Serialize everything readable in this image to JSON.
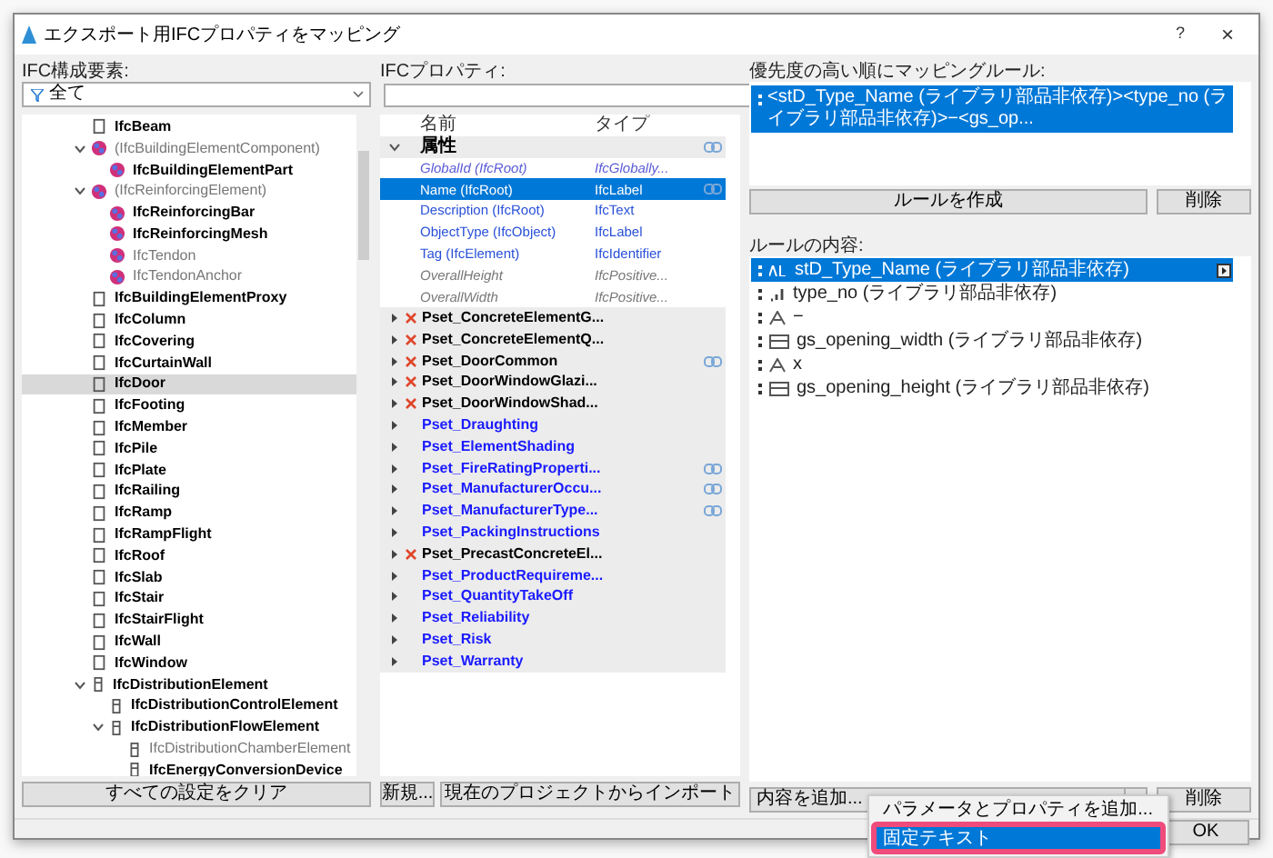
{
  "window": {
    "title": "エクスポート用IFCプロパティをマッピング",
    "help": "?",
    "close": "×"
  },
  "elements": {
    "label": "IFC構成要素:",
    "filter": "全て",
    "clear_button": "すべての設定をクリア",
    "tree": [
      {
        "label": "IfcBeam",
        "kind": "element",
        "dimmed": false,
        "selected": false
      },
      {
        "label": "(IfcBuildingElementComponent)",
        "kind": "component",
        "dimmed": true,
        "selected": false,
        "expanded": true,
        "children": [
          {
            "label": "IfcBuildingElementPart",
            "kind": "component",
            "dimmed": false,
            "selected": false
          }
        ]
      },
      {
        "label": "(IfcReinforcingElement)",
        "kind": "component",
        "dimmed": true,
        "selected": false,
        "expanded": true,
        "children": [
          {
            "label": "IfcReinforcingBar",
            "kind": "component",
            "dimmed": false,
            "selected": false
          },
          {
            "label": "IfcReinforcingMesh",
            "kind": "component",
            "dimmed": false,
            "selected": false
          },
          {
            "label": "IfcTendon",
            "kind": "component",
            "dimmed": true,
            "selected": false
          },
          {
            "label": "IfcTendonAnchor",
            "kind": "component",
            "dimmed": true,
            "selected": false
          }
        ]
      },
      {
        "label": "IfcBuildingElementProxy",
        "kind": "element",
        "dimmed": false,
        "selected": false
      },
      {
        "label": "IfcColumn",
        "kind": "element",
        "dimmed": false,
        "selected": false
      },
      {
        "label": "IfcCovering",
        "kind": "element",
        "dimmed": false,
        "selected": false
      },
      {
        "label": "IfcCurtainWall",
        "kind": "element",
        "dimmed": false,
        "selected": false
      },
      {
        "label": "IfcDoor",
        "kind": "element",
        "dimmed": false,
        "selected": true
      },
      {
        "label": "IfcFooting",
        "kind": "element",
        "dimmed": false,
        "selected": false
      },
      {
        "label": "IfcMember",
        "kind": "element",
        "dimmed": false,
        "selected": false
      },
      {
        "label": "IfcPile",
        "kind": "element",
        "dimmed": false,
        "selected": false
      },
      {
        "label": "IfcPlate",
        "kind": "element",
        "dimmed": false,
        "selected": false
      },
      {
        "label": "IfcRailing",
        "kind": "element",
        "dimmed": false,
        "selected": false
      },
      {
        "label": "IfcRamp",
        "kind": "element",
        "dimmed": false,
        "selected": false
      },
      {
        "label": "IfcRampFlight",
        "kind": "element",
        "dimmed": false,
        "selected": false
      },
      {
        "label": "IfcRoof",
        "kind": "element",
        "dimmed": false,
        "selected": false
      },
      {
        "label": "IfcSlab",
        "kind": "element",
        "dimmed": false,
        "selected": false
      },
      {
        "label": "IfcStair",
        "kind": "element",
        "dimmed": false,
        "selected": false
      },
      {
        "label": "IfcStairFlight",
        "kind": "element",
        "dimmed": false,
        "selected": false
      },
      {
        "label": "IfcWall",
        "kind": "element",
        "dimmed": false,
        "selected": false
      },
      {
        "label": "IfcWindow",
        "kind": "element",
        "dimmed": false,
        "selected": false
      },
      {
        "label": "IfcDistributionElement",
        "kind": "distribution",
        "dimmed": false,
        "selected": false,
        "expanded": true,
        "children": [
          {
            "label": "IfcDistributionControlElement",
            "kind": "distribution",
            "dimmed": false,
            "selected": false
          },
          {
            "label": "IfcDistributionFlowElement",
            "kind": "distribution",
            "dimmed": false,
            "selected": false,
            "expanded": true,
            "children": [
              {
                "label": "IfcDistributionChamberElement",
                "kind": "distribution",
                "dimmed": true,
                "selected": false
              },
              {
                "label": "IfcEnergyConversionDevice",
                "kind": "distribution",
                "dimmed": false,
                "selected": false
              }
            ]
          }
        ]
      }
    ]
  },
  "properties": {
    "label": "IFCプロパティ:",
    "columns": [
      "名前",
      "タイプ"
    ],
    "group": {
      "label": "属性",
      "expanded": true,
      "linked": true
    },
    "attributes": [
      {
        "name": "GlobalId (IfcRoot)",
        "type": "IfcGlobally...",
        "kind": "calculated",
        "linked": false,
        "selected": false
      },
      {
        "name": "Name (IfcRoot)",
        "type": "IfcLabel",
        "kind": "editable",
        "linked": true,
        "selected": true
      },
      {
        "name": "Description (IfcRoot)",
        "type": "IfcText",
        "kind": "editable",
        "linked": false,
        "selected": false
      },
      {
        "name": "ObjectType (IfcObject)",
        "type": "IfcLabel",
        "kind": "editable",
        "linked": false,
        "selected": false
      },
      {
        "name": "Tag (IfcElement)",
        "type": "IfcIdentifier",
        "kind": "editable",
        "linked": false,
        "selected": false
      },
      {
        "name": "OverallHeight",
        "type": "IfcPositive...",
        "kind": "unavailable",
        "linked": false,
        "selected": false
      },
      {
        "name": "OverallWidth",
        "type": "IfcPositive...",
        "kind": "unavailable",
        "linked": false,
        "selected": false
      }
    ],
    "psets": [
      {
        "name": "Pset_ConcreteElementG...",
        "missing": true,
        "linked": false
      },
      {
        "name": "Pset_ConcreteElementQ...",
        "missing": true,
        "linked": false
      },
      {
        "name": "Pset_DoorCommon",
        "missing": true,
        "linked": true
      },
      {
        "name": "Pset_DoorWindowGlazi...",
        "missing": true,
        "linked": false
      },
      {
        "name": "Pset_DoorWindowShad...",
        "missing": true,
        "linked": false
      },
      {
        "name": "Pset_Draughting",
        "missing": false,
        "linked": false
      },
      {
        "name": "Pset_ElementShading",
        "missing": false,
        "linked": false
      },
      {
        "name": "Pset_FireRatingProperti...",
        "missing": false,
        "linked": true
      },
      {
        "name": "Pset_ManufacturerOccu...",
        "missing": false,
        "linked": true
      },
      {
        "name": "Pset_ManufacturerType...",
        "missing": false,
        "linked": true
      },
      {
        "name": "Pset_PackingInstructions",
        "missing": false,
        "linked": false
      },
      {
        "name": "Pset_PrecastConcreteEl...",
        "missing": true,
        "linked": false
      },
      {
        "name": "Pset_ProductRequireme...",
        "missing": false,
        "linked": false
      },
      {
        "name": "Pset_QuantityTakeOff",
        "missing": false,
        "linked": false
      },
      {
        "name": "Pset_Reliability",
        "missing": false,
        "linked": false
      },
      {
        "name": "Pset_Risk",
        "missing": false,
        "linked": false
      },
      {
        "name": "Pset_Warranty",
        "missing": false,
        "linked": false
      }
    ],
    "buttons": [
      "新規...",
      "現在のプロジェクトからインポート"
    ]
  },
  "rules": {
    "label": "優先度の高い順にマッピングルール:",
    "items": [
      {
        "text": "<stD_Type_Name (ライブラリ部品非依存)><type_no (ライブラリ部品非依存)>−<gs_op...",
        "selected": true
      }
    ],
    "create_button": "ルールを作成",
    "delete_button": "削除"
  },
  "content": {
    "label": "ルールの内容:",
    "items": [
      {
        "text": "stD_Type_Name (ライブラリ部品非依存)",
        "kind": "string",
        "selected": true
      },
      {
        "text": "type_no (ライブラリ部品非依存)",
        "kind": "number",
        "selected": false
      },
      {
        "text": "−",
        "kind": "text",
        "selected": false
      },
      {
        "text": "gs_opening_width (ライブラリ部品非依存)",
        "kind": "length",
        "selected": false
      },
      {
        "text": "x",
        "kind": "text",
        "selected": false
      },
      {
        "text": "gs_opening_height (ライブラリ部品非依存)",
        "kind": "length",
        "selected": false
      }
    ],
    "add_button": "内容を追加...",
    "delete_button": "削除"
  },
  "menu": {
    "items": [
      {
        "label": "パラメータとプロパティを追加...",
        "selected": false,
        "highlighted": false
      },
      {
        "label": "固定テキスト",
        "selected": true,
        "highlighted": true
      }
    ]
  },
  "footer": {
    "ok": "OK"
  }
}
